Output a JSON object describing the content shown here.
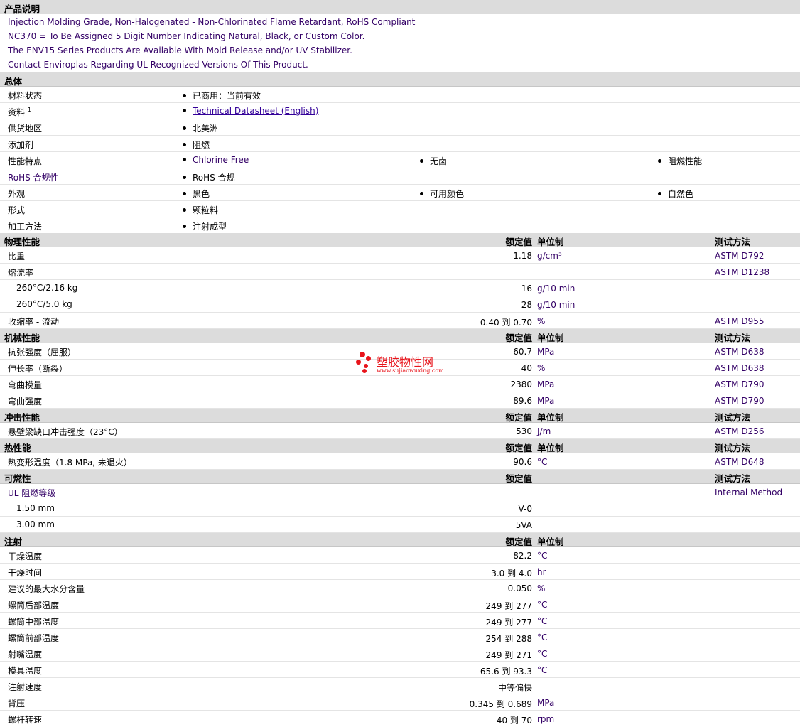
{
  "product": {
    "title": "产品说明",
    "lines": [
      "Injection Molding Grade, Non-Halogenated - Non-Chlorinated Flame Retardant, RoHS Compliant",
      "NC370 = To Be Assigned 5 Digit Number Indicating Natural, Black, or Custom Color.",
      "The ENV15 Series Products Are Available With Mold Release and/or UV Stabilizer.",
      "Contact Enviroplas Regarding UL Recognized Versions Of This Product."
    ]
  },
  "general": {
    "title": "总体",
    "rows": [
      {
        "label": "材料状态",
        "items": [
          "已商用：当前有效"
        ]
      },
      {
        "label": "资料",
        "sup": "1",
        "items": [
          "Technical Datasheet (English)"
        ]
      },
      {
        "label": "供货地区",
        "items": [
          "北美洲"
        ]
      },
      {
        "label": "添加剂",
        "items": [
          "阻燃"
        ]
      },
      {
        "label": "性能特点",
        "items": [
          "Chlorine Free",
          "无卤",
          "阻燃性能"
        ]
      },
      {
        "label": "RoHS 合规性",
        "items": [
          "RoHS 合规"
        ]
      },
      {
        "label": "外观",
        "items": [
          "黑色",
          "可用颜色",
          "自然色"
        ]
      },
      {
        "label": "形式",
        "items": [
          "颗粒料"
        ]
      },
      {
        "label": "加工方法",
        "items": [
          "注射成型"
        ]
      }
    ]
  },
  "columns": {
    "value": "额定值",
    "unit": "单位制",
    "method": "测试方法"
  },
  "physical": {
    "title": "物理性能",
    "rows": [
      {
        "label": "比重",
        "value": "1.18",
        "unit": "g/cm³",
        "method": "ASTM D792"
      },
      {
        "label": "熔流率",
        "value": "",
        "unit": "",
        "method": "ASTM D1238"
      },
      {
        "label": "260°C/2.16 kg",
        "value": "16",
        "unit": "g/10 min",
        "method": ""
      },
      {
        "label": "260°C/5.0 kg",
        "value": "28",
        "unit": "g/10 min",
        "method": ""
      },
      {
        "label": "收缩率 - 流动",
        "value": "0.40 到  0.70",
        "unit": "%",
        "method": "ASTM D955"
      }
    ]
  },
  "mechanical": {
    "title": "机械性能",
    "rows": [
      {
        "label": "抗张强度（屈服）",
        "value": "60.7",
        "unit": "MPa",
        "method": "ASTM D638"
      },
      {
        "label": "伸长率（断裂）",
        "value": "40",
        "unit": "%",
        "method": "ASTM D638"
      },
      {
        "label": "弯曲模量",
        "value": "2380",
        "unit": "MPa",
        "method": "ASTM D790"
      },
      {
        "label": "弯曲强度",
        "value": "89.6",
        "unit": "MPa",
        "method": "ASTM D790"
      }
    ]
  },
  "impact": {
    "title": "冲击性能",
    "rows": [
      {
        "label": "悬壁梁缺口冲击强度（23°C）",
        "value": "530",
        "unit": "J/m",
        "method": "ASTM D256"
      }
    ]
  },
  "thermal": {
    "title": "热性能",
    "rows": [
      {
        "label": "热变形温度（1.8 MPa, 未退火）",
        "value": "90.6",
        "unit": "°C",
        "method": "ASTM D648"
      }
    ]
  },
  "flammability": {
    "title": "可燃性",
    "rows": [
      {
        "label": "UL 阻燃等级",
        "value": "",
        "unit": "",
        "method": "Internal Method"
      },
      {
        "label": "1.50 mm",
        "value": "V-0",
        "unit": "",
        "method": ""
      },
      {
        "label": "3.00 mm",
        "value": "5VA",
        "unit": "",
        "method": ""
      }
    ]
  },
  "injection": {
    "title": "注射",
    "rows": [
      {
        "label": "干燥温度",
        "value": "82.2",
        "unit": "°C"
      },
      {
        "label": "干燥时间",
        "value": "3.0 到  4.0",
        "unit": "hr"
      },
      {
        "label": "建议的最大水分含量",
        "value": "0.050",
        "unit": "%"
      },
      {
        "label": "螺筒后部温度",
        "value": "249 到  277",
        "unit": "°C"
      },
      {
        "label": "螺筒中部温度",
        "value": "249 到  277",
        "unit": "°C"
      },
      {
        "label": "螺筒前部温度",
        "value": "254 到  288",
        "unit": "°C"
      },
      {
        "label": "射嘴温度",
        "value": "249 到  271",
        "unit": "°C"
      },
      {
        "label": "模具温度",
        "value": "65.6 到  93.3",
        "unit": "°C"
      },
      {
        "label": "注射速度",
        "value": "中等偏快",
        "unit": ""
      },
      {
        "label": "背压",
        "value": "0.345 到  0.689",
        "unit": "MPa"
      },
      {
        "label": "螺杆转速",
        "value": "40 到  70",
        "unit": "rpm"
      }
    ]
  },
  "watermark": {
    "name": "塑胶物性网",
    "url": "www.sujiaowuxing.com",
    "color": "#e8141b"
  }
}
